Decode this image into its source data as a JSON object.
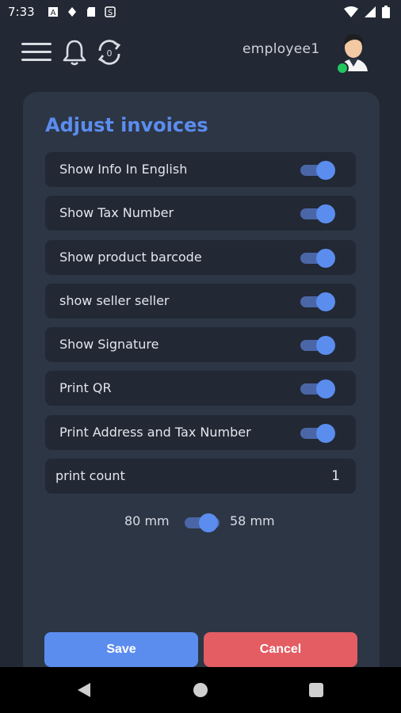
{
  "status_bar": {
    "time": "7:33",
    "left_icons": [
      "font-icon",
      "vpn-icon",
      "sd-card-icon",
      "sync-icon"
    ],
    "right_icons": [
      "wifi-icon",
      "signal-icon",
      "battery-icon"
    ]
  },
  "header": {
    "username": "employee1",
    "icons": [
      "menu-icon",
      "bell-icon",
      "refresh-icon"
    ],
    "refresh_badge": "0"
  },
  "card": {
    "title": "Adjust invoices",
    "options": [
      {
        "label": "Show Info In English",
        "enabled": true
      },
      {
        "label": "Show Tax Number",
        "enabled": true
      },
      {
        "label": "Show product barcode",
        "enabled": true
      },
      {
        "label": "show seller seller",
        "enabled": true
      },
      {
        "label": "Show Signature",
        "enabled": true
      },
      {
        "label": "Print QR",
        "enabled": true
      },
      {
        "label": "Print Address and Tax Number",
        "enabled": true
      }
    ],
    "print_count": {
      "label": "print count",
      "value": "1"
    },
    "paper_size": {
      "left_label": "80 mm",
      "right_label": "58 mm",
      "selected": "58 mm"
    },
    "save_label": "Save",
    "cancel_label": "Cancel"
  },
  "colors": {
    "background": "#222834",
    "card": "#2d3645",
    "accent": "#5b8def",
    "danger": "#e35d63"
  }
}
